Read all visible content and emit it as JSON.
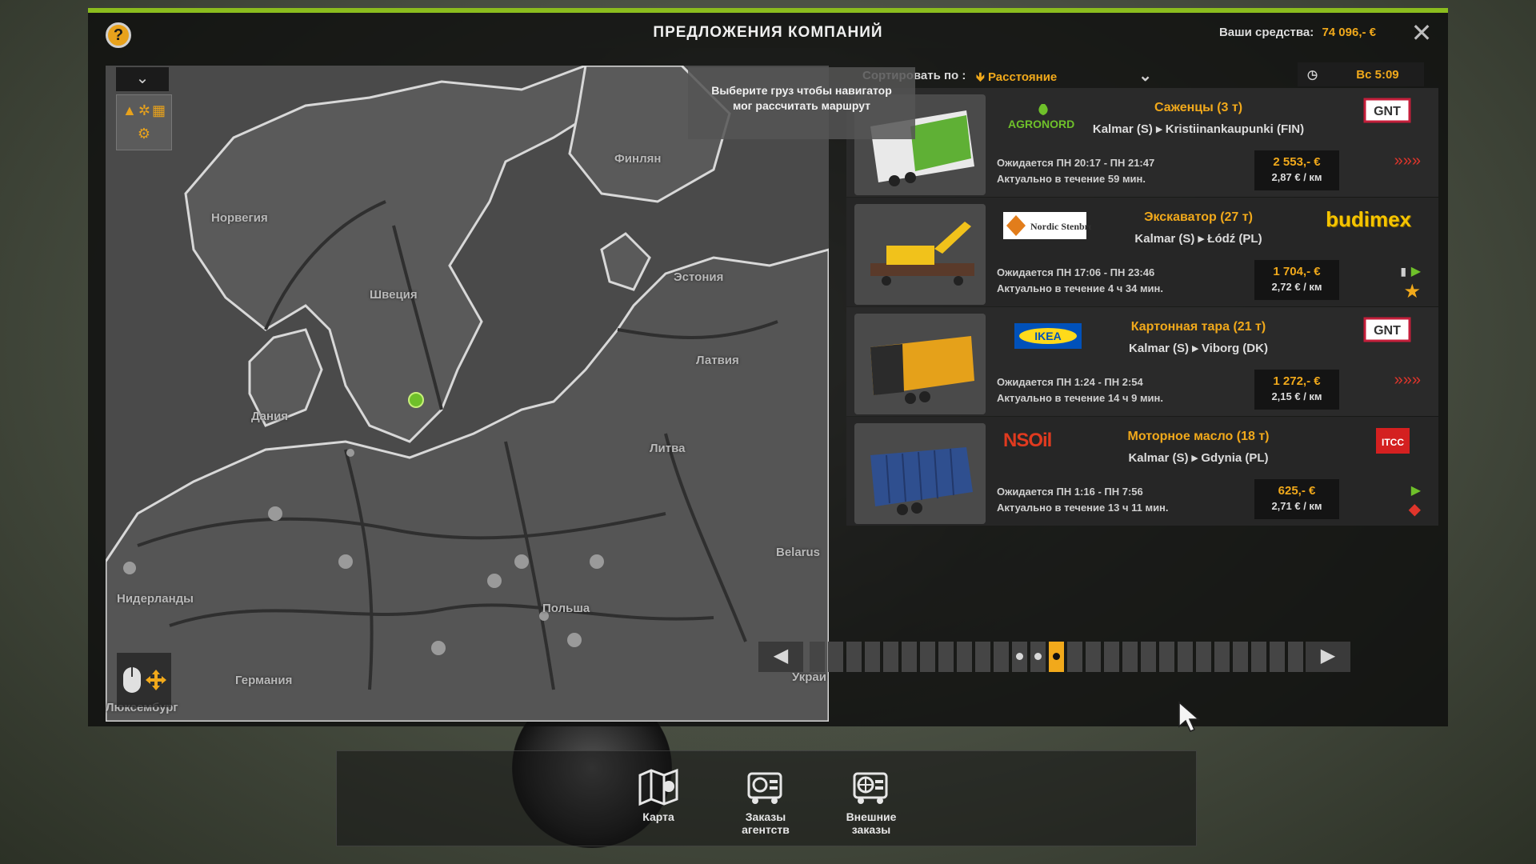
{
  "window": {
    "title": "ПРЕДЛОЖЕНИЯ КОМПАНИЙ",
    "funds_label": "Ваши средства:",
    "funds_value": "74 096,- €",
    "help": "?",
    "close": "✕"
  },
  "map": {
    "hint_line1": "Выберите груз чтобы навигатор",
    "hint_line2": "мог рассчитать маршрут",
    "toggle": "⌄",
    "labels": {
      "norway": "Норвегия",
      "finland": "Финлян",
      "sweden": "Швеция",
      "estonia": "Эстония",
      "latvia": "Латвия",
      "denmark": "Дания",
      "lithuania": "Литва",
      "belarus": "Belarus",
      "netherlands": "Нидерланды",
      "poland": "Польша",
      "germany": "Германия",
      "luxembourg": "Люксембург",
      "ukraine": "Украи"
    }
  },
  "sort": {
    "label": "Сортировать по :",
    "value": "Расстояние",
    "arrow": "🡻",
    "time": "Вс 5:09"
  },
  "jobs": [
    {
      "cargo": "Саженцы (3 т)",
      "route": "Kalmar (S)  ▸  Kristiinankaupunki (FIN)",
      "expected": "Ожидается ПН 20:17 - ПН 21:47",
      "valid": "Актуально в течение 59 мин.",
      "total": "2 553,- €",
      "per_km": "2,87 € / км",
      "logo_left": "AGRONORD",
      "logo_right": "GNT",
      "indicator": "»»»"
    },
    {
      "cargo": "Экскаватор (27 т)",
      "route": "Kalmar (S)  ▸  Łódź (PL)",
      "expected": "Ожидается ПН 17:06 - ПН 23:46",
      "valid": "Актуально в течение 4 ч 34 мин.",
      "total": "1 704,- €",
      "per_km": "2,72 € / км",
      "logo_left": "Nordic Stenbrott",
      "logo_right": "budimex",
      "indicator": "▶"
    },
    {
      "cargo": "Картонная тара (21 т)",
      "route": "Kalmar (S)  ▸  Viborg (DK)",
      "expected": "Ожидается ПН 1:24 - ПН 2:54",
      "valid": "Актуально в течение 14 ч 9 мин.",
      "total": "1 272,- €",
      "per_km": "2,15 € / км",
      "logo_left": "IKEA",
      "logo_right": "GNT",
      "indicator": "»»»"
    },
    {
      "cargo": "Моторное масло (18 т)",
      "route": "Kalmar (S)  ▸  Gdynia (PL)",
      "expected": "Ожидается ПН 1:16 - ПН 7:56",
      "valid": "Актуально в течение 13 ч 11 мин.",
      "total": "625,- €",
      "per_km": "2,71 € / км",
      "logo_left": "NSOil",
      "logo_right": "ITCC",
      "indicator": "▶"
    }
  ],
  "pager": {
    "prev": "◀",
    "next": "▶",
    "total_pages": 27,
    "seen_pages": [
      12,
      13
    ],
    "current_page": 14
  },
  "bottom_nav": [
    {
      "label_line1": "Карта",
      "label_line2": "",
      "icon": "map-icon"
    },
    {
      "label_line1": "Заказы",
      "label_line2": "агентств",
      "icon": "agency-orders-icon"
    },
    {
      "label_line1": "Внешние",
      "label_line2": "заказы",
      "icon": "external-orders-icon"
    }
  ],
  "colors": {
    "accent": "#f1a91b",
    "top_bar": "#8bbd1e",
    "player_marker": "#6fc02a"
  }
}
